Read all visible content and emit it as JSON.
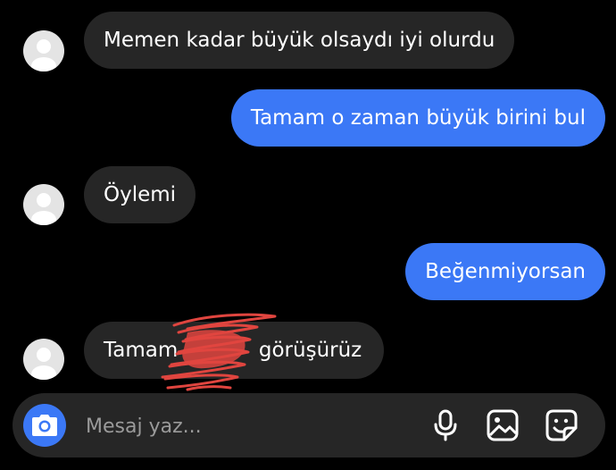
{
  "messages": [
    {
      "direction": "incoming",
      "text": "Memen kadar büyük olsaydı iyi olurdu"
    },
    {
      "direction": "outgoing",
      "text": "Tamam o zaman büyük birini bul"
    },
    {
      "direction": "incoming",
      "text": "Öylemi"
    },
    {
      "direction": "outgoing",
      "text": "Beğenmiyorsan"
    },
    {
      "direction": "incoming",
      "text": "Tamam görüşürüz",
      "text_left": "Tamam",
      "text_right": "görüşürüz",
      "redacted": true
    }
  ],
  "composer": {
    "placeholder": "Mesaj yaz...",
    "camera_icon": "camera-icon",
    "mic_icon": "microphone-icon",
    "gallery_icon": "image-gallery-icon",
    "sticker_icon": "sticker-icon"
  },
  "colors": {
    "background": "#000000",
    "incoming_bubble": "#262626",
    "outgoing_bubble": "#3b78f6",
    "redaction_scribble": "#e0453f"
  }
}
